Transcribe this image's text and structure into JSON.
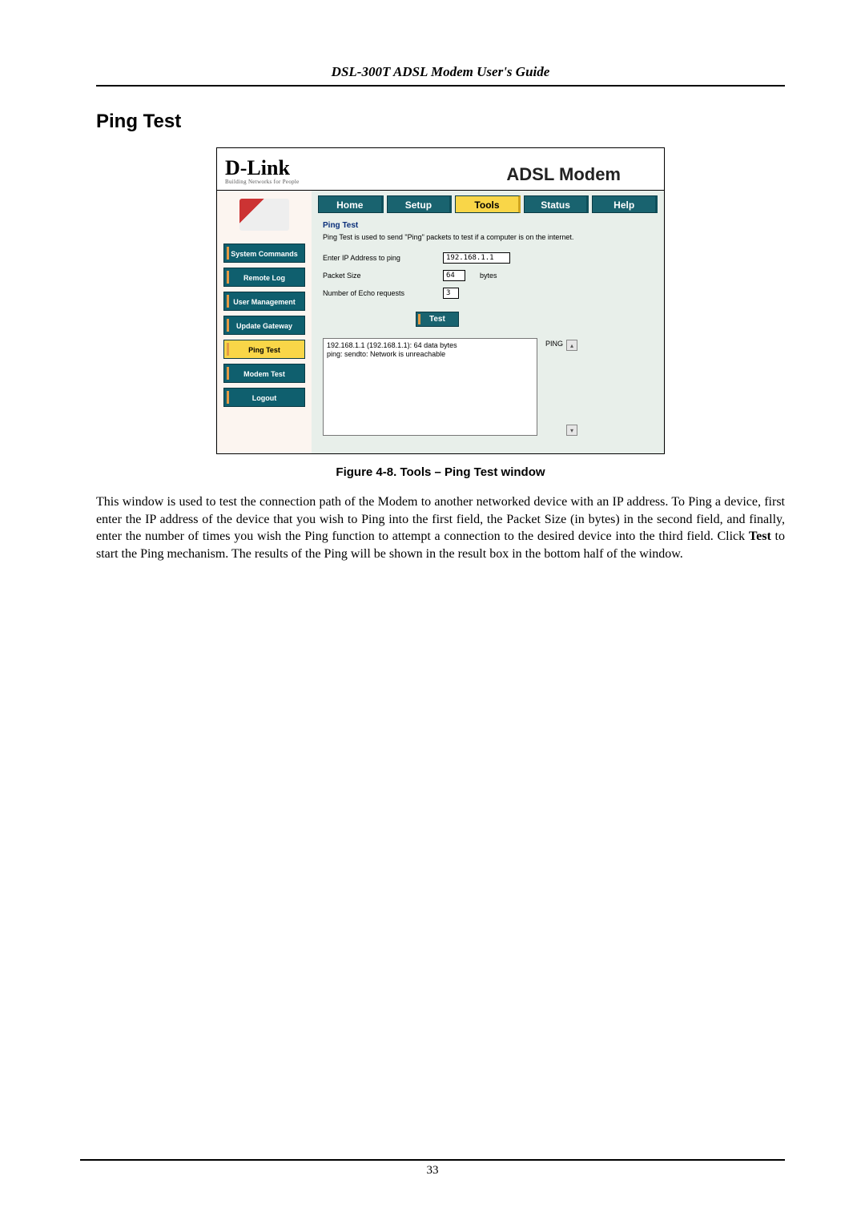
{
  "doc": {
    "guide_header": "DSL-300T ADSL Modem User's Guide",
    "page_title": "Ping Test",
    "figure_caption": "Figure 4-8. Tools – Ping Test window",
    "page_number": "33",
    "body": "This window is used to test the connection path of the Modem to another networked device with an IP address. To Ping a device, first enter the IP address of the device that you wish to Ping into the first field, the Packet Size (in bytes) in the second field, and finally, enter the number of times you wish the Ping function to attempt a connection to the desired device into the third field. Click ",
    "body_bold": "Test",
    "body_tail": " to start the Ping mechanism. The results of the Ping will be shown in the result box in the bottom half of the window."
  },
  "shot": {
    "brand_main": "D-Link",
    "brand_sub": "Building Networks for People",
    "product_title": "ADSL Modem",
    "tabs": {
      "home": "Home",
      "setup": "Setup",
      "tools": "Tools",
      "status": "Status",
      "help": "Help"
    },
    "sidebar": {
      "system_commands": "System Commands",
      "remote_log": "Remote Log",
      "user_management": "User Management",
      "update_gateway": "Update Gateway",
      "ping_test": "Ping Test",
      "modem_test": "Modem Test",
      "logout": "Logout"
    },
    "main": {
      "title": "Ping Test",
      "desc": "Ping Test is used to send \"Ping\" packets to test if a computer is on the internet.",
      "ip_label": "Enter IP Address to ping",
      "ip_value": "192.168.1.1",
      "packet_label": "Packet Size",
      "packet_value": "64",
      "packet_unit": "bytes",
      "echo_label": "Number of Echo requests",
      "echo_value": "3",
      "test_btn": "Test",
      "ping_word": "PING",
      "result_line1": "192.168.1.1 (192.168.1.1): 64 data bytes",
      "result_line2": "ping: sendto: Network is unreachable"
    }
  }
}
